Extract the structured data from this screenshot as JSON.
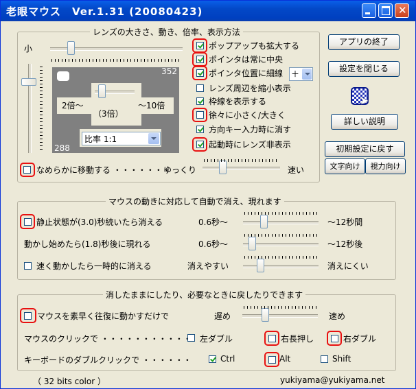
{
  "window": {
    "title": "老眼マウス　Ver.1.31 (20080423)"
  },
  "lens_group": {
    "title": "レンズの大きさ、動き、倍率、表示方法",
    "small_label": "小",
    "preview": {
      "max_size": "352",
      "min_size": "288",
      "zoom_min": "2倍〜",
      "zoom_current": "（3倍）",
      "zoom_max": "〜10倍"
    },
    "ratio": {
      "value": "比率 1:1"
    },
    "checks": [
      {
        "label": "ポップアップも拡大する",
        "checked": true
      },
      {
        "label": "ポインタは常に中央",
        "checked": true
      },
      {
        "label": "ポインタ位置に細線",
        "checked": true
      },
      {
        "label": "レンズ周辺を縮小表示",
        "checked": false
      },
      {
        "label": "枠線を表示する",
        "checked": true
      },
      {
        "label": "徐々に小さく/大きく",
        "checked": false
      },
      {
        "label": "方向キー入力時に消す",
        "checked": true
      },
      {
        "label": "起動時にレンズ非表示",
        "checked": true
      }
    ],
    "line_combo": {
      "value": "＋"
    },
    "smooth": {
      "label": "なめらかに移動する ・・・・・・・",
      "checked": false,
      "slow": "ゆっくり",
      "fast": "速い"
    }
  },
  "side_buttons": {
    "quit": "アプリの終了",
    "close_settings": "設定を閉じる",
    "details": "詳しい説明",
    "reset": "初期設定に戻す",
    "for_text": "文字向け",
    "for_vision": "視力向け"
  },
  "auto_group": {
    "title": "マウスの動きに対応して自動で消え、現れます",
    "rows": [
      {
        "label": "静止状態が(3.0)秒続いたら消える",
        "checked": false,
        "min": "0.6秒〜",
        "max": "〜12秒間",
        "value": 0.25
      },
      {
        "label": "動かし始めたら(1.8)秒後に現れる",
        "min": "0.6秒〜",
        "max": "〜12秒後",
        "value": 0.08
      },
      {
        "label": "速く動かしたら一時的に消える",
        "checked": false,
        "min": "消えやすい",
        "max": "消えにくい",
        "value": 0.2
      }
    ]
  },
  "manual_group": {
    "title": "消したままにしたり、必要なときに戻したりできます",
    "shake": {
      "label": "マウスを素早く往復に動かすだけで",
      "checked": false,
      "slow": "遅め",
      "fast": "速め",
      "value": 0.25
    },
    "click": {
      "label": "マウスのクリックで ・・・・・・・・・・・",
      "options": [
        {
          "label": "左ダブル",
          "checked": false
        },
        {
          "label": "右長押し",
          "checked": false
        },
        {
          "label": "右ダブル",
          "checked": false
        }
      ]
    },
    "keyboard": {
      "label": "キーボードのダブルクリックで ・・・・・・",
      "options": [
        {
          "label": "Ctrl",
          "checked": true
        },
        {
          "label": "Alt",
          "checked": false
        },
        {
          "label": "Shift",
          "checked": false
        }
      ]
    }
  },
  "footer": {
    "color_depth": "（ 32 bits color ）",
    "email": "yukiyama@yukiyama.net"
  }
}
